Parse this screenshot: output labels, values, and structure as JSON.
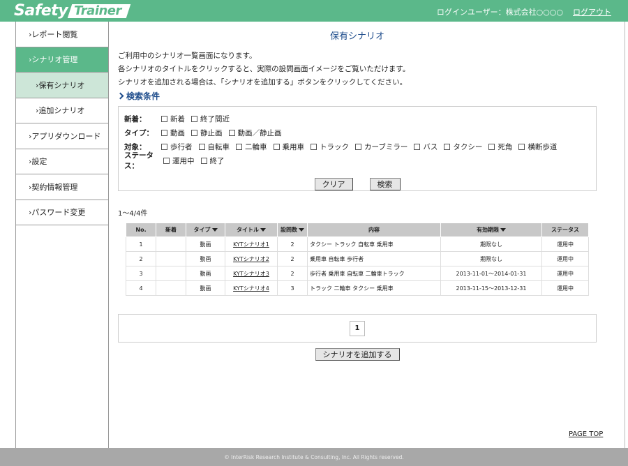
{
  "header": {
    "logo_left": "Safety",
    "logo_right": "Trainer",
    "login_user": "ログインユーザー：株式会社○○○○",
    "logout": "ログアウト"
  },
  "sidebar": {
    "items": [
      {
        "label": "›レポート閲覧"
      },
      {
        "label": "›シナリオ管理"
      },
      {
        "label": "›保有シナリオ"
      },
      {
        "label": "›追加シナリオ"
      },
      {
        "label": "›アプリダウンロード"
      },
      {
        "label": "›設定"
      },
      {
        "label": "›契約情報管理"
      },
      {
        "label": "›パスワード変更"
      }
    ]
  },
  "main": {
    "title": "保有シナリオ",
    "desc": [
      "ご利用中のシナリオ一覧画面になります。",
      "各シナリオのタイトルをクリックすると、実際の設問画面イメージをご覧いただけます。",
      "シナリオを追加される場合は、「シナリオを追加する」ボタンをクリックしてください。"
    ],
    "search_title": "検索条件"
  },
  "search": {
    "new_label": "新着：",
    "new_opts": [
      "新着",
      "終了間近"
    ],
    "type_label": "タイプ：",
    "type_opts": [
      "動画",
      "静止画",
      "動画／静止画"
    ],
    "target_label": "対象：",
    "target_opts": [
      "歩行者",
      "自転車",
      "二輪車",
      "乗用車",
      "トラック",
      "カーブミラー",
      "バス",
      "タクシー",
      "死角",
      "横断歩道"
    ],
    "status_label": "ステータス：",
    "status_opts": [
      "運用中",
      "終了"
    ],
    "clear_btn": "クリア",
    "search_btn": "検索"
  },
  "list": {
    "count": "1〜4/4件",
    "headers": [
      "No.",
      "新着",
      "タイプ",
      "タイトル",
      "設問数",
      "内容",
      "有効期限",
      "ステータス"
    ],
    "rows": [
      [
        "1",
        "",
        "動画",
        "KYTシナリオ1",
        "2",
        "タクシー トラック 自転車 乗用車",
        "期限なし",
        "運用中"
      ],
      [
        "2",
        "",
        "動画",
        "KYTシナリオ2",
        "2",
        "乗用車 自転車 歩行者",
        "期限なし",
        "運用中"
      ],
      [
        "3",
        "",
        "動画",
        "KYTシナリオ3",
        "2",
        "歩行者 乗用車 自転車 二輪車トラック",
        "2013-11-01～2014-01-31",
        "運用中"
      ],
      [
        "4",
        "",
        "動画",
        "KYTシナリオ4",
        "3",
        "トラック 二輪車 タクシー 乗用車",
        "2013-11-15～2013-12-31",
        "運用中"
      ]
    ]
  },
  "pager": {
    "current": "1"
  },
  "add_btn": "シナリオを追加する",
  "pagetop": "PAGE TOP",
  "footer": "© InterRisk Research Institute & Consulting, Inc. All Rights reserved."
}
